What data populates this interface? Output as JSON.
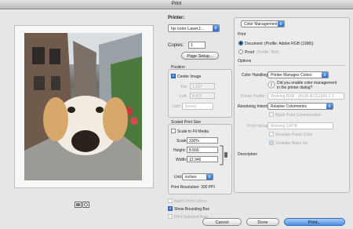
{
  "window": {
    "title": "Print"
  },
  "printer": {
    "label": "Printer:",
    "value": "hp color LaserJ..."
  },
  "copies": {
    "label": "Copies:",
    "value": "1"
  },
  "page_setup_label": "Page Setup...",
  "position": {
    "title": "Position",
    "center_image": "Center Image",
    "top_label": "Top:",
    "top_value": "1.167",
    "left_label": "Left:",
    "left_value": "0.472",
    "unit_label": "Unit:",
    "unit_value": "inches"
  },
  "scaled": {
    "title": "Scaled Print Size",
    "scale_to_fit": "Scale to Fit Media",
    "scale_label": "Scale:",
    "scale_value": "100%",
    "height_label": "Height:",
    "height_value": "8.666",
    "width_label": "Width:",
    "width_value": "12.946",
    "unit_label": "Unit:",
    "unit_value": "inches",
    "resolution": "Print Resolution: 300 PPI"
  },
  "options_bottom": {
    "match_print_colors": "Match Print Colors",
    "show_bounding_box": "Show Bounding Box",
    "print_selected_area": "Print Selected Area"
  },
  "color": {
    "section_popup": "Color Management",
    "print_heading": "Print",
    "document_label": "Document",
    "document_profile": "(Profile: Adobe RGB (1998))",
    "proof_label": "Proof",
    "proof_profile": "(Profile: N/A)",
    "options_heading": "Options",
    "color_handling_label": "Color Handling:",
    "color_handling_value": "Printer Manages Colors",
    "question": "Did you enable color management in the printer dialog?",
    "printer_profile_label": "Printer Profile:",
    "printer_profile_value": "Working RGB - sRGB IEC61966-2.1",
    "rendering_intent_label": "Rendering Intent:",
    "rendering_intent_value": "Relative Colorimetric",
    "black_point": "Black Point Compensation",
    "proof_setup_label": "Proof Setup:",
    "proof_setup_value": "Working CMYK",
    "simulate_paper": "Simulate Paper Color",
    "simulate_black": "Simulate Black Ink",
    "description_heading": "Description"
  },
  "buttons": {
    "cancel": "Cancel",
    "done": "Done",
    "print": "Print..."
  },
  "colors": {
    "accent": "#3b7fd9",
    "default_button": "#4a8fe0"
  }
}
